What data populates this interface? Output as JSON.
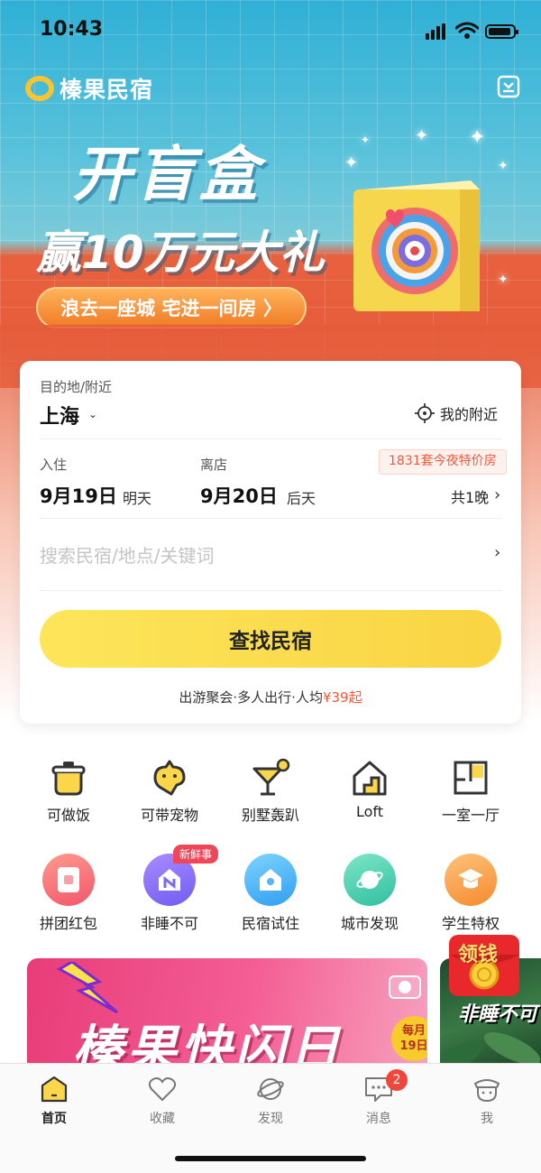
{
  "status": {
    "time": "10:43"
  },
  "brand": {
    "name": "榛果民宿"
  },
  "banner": {
    "title": "开盲盒",
    "subtitle": "赢10万元大礼",
    "pill": "浪去一座城 宅进一间房 〉"
  },
  "search_card": {
    "destination_label": "目的地/附近",
    "city": "上海",
    "nearby": "我的附近",
    "checkin_label": "入住",
    "checkin_date": "9月19日",
    "checkin_day": "明天",
    "checkout_label": "离店",
    "checkout_date": "9月20日",
    "checkout_day": "后天",
    "deal_tag": "1831套今夜特价房",
    "nights": "共1晚",
    "search_placeholder": "搜索民宿/地点/关键词",
    "search_button": "查找民宿",
    "group_tip": "出游聚会·多人出行·人均",
    "group_price": "¥39起"
  },
  "categories_row1": [
    {
      "label": "可做饭"
    },
    {
      "label": "可带宠物"
    },
    {
      "label": "别墅轰趴"
    },
    {
      "label": "Loft"
    },
    {
      "label": "一室一厅"
    }
  ],
  "categories_row2": [
    {
      "label": "拼团红包"
    },
    {
      "label": "非睡不可",
      "badge": "新鲜事"
    },
    {
      "label": "民宿试住"
    },
    {
      "label": "城市发现"
    },
    {
      "label": "学生特权"
    }
  ],
  "promos": {
    "flash_title": "榛果快闪日",
    "flash_badge_1": "每月",
    "flash_badge_2": "19日",
    "side_title": "非睡不可",
    "redpack_label": "领钱"
  },
  "tabs": [
    {
      "label": "首页"
    },
    {
      "label": "收藏"
    },
    {
      "label": "发现"
    },
    {
      "label": "消息",
      "badge": "2"
    },
    {
      "label": "我"
    }
  ],
  "colors": {
    "accent_yellow": "#f9d443",
    "price_red": "#f0593c",
    "badge_red": "#f0463c"
  }
}
